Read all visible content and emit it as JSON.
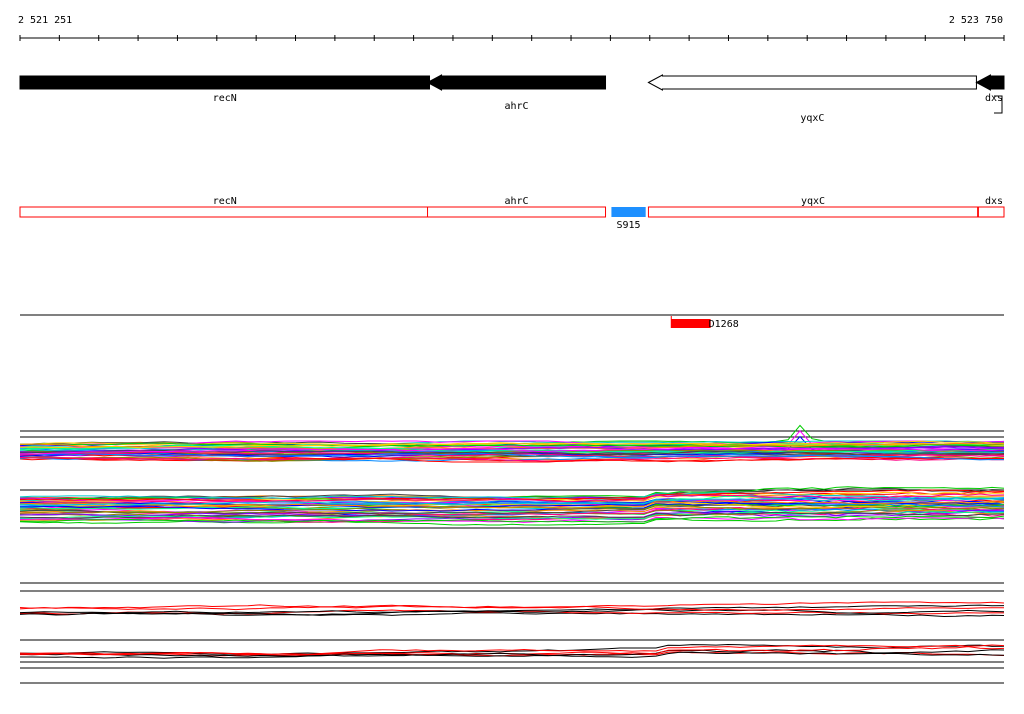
{
  "axis": {
    "start_label": "2 521 251",
    "end_label": "2 523 750",
    "start": 2521251,
    "end": 2523750,
    "tick_count": 26
  },
  "genes": [
    {
      "label": "recN",
      "strand": "-",
      "style": "filled",
      "start": 2521251,
      "end": 2522291
    },
    {
      "label": "ahrC",
      "strand": "-",
      "style": "filled",
      "start": 2522286,
      "end": 2522738
    },
    {
      "label": "yqxC",
      "strand": "-",
      "style": "outline",
      "start": 2522847,
      "end": 2523680
    },
    {
      "label": "dxs",
      "strand": "-",
      "style": "filled",
      "start": 2523680,
      "end": 2523750
    }
  ],
  "transcripts": [
    {
      "label": "recN",
      "start": 2521251,
      "end": 2522291
    },
    {
      "label": "ahrC",
      "start": 2522286,
      "end": 2522738
    },
    {
      "label": "yqxC",
      "start": 2522847,
      "end": 2523683
    },
    {
      "label": "dxs",
      "start": 2523685,
      "end": 2523750
    }
  ],
  "features": [
    {
      "label": "S915",
      "color": "#1e90ff",
      "start": 2522753,
      "end": 2522840
    }
  ],
  "peaks": [
    {
      "label": "D1268",
      "color": "#ff0000",
      "start": 2522905,
      "end": 2523005
    }
  ],
  "colors": {
    "transcript_outline": "#ff0000",
    "track_line": "#000000",
    "profile_palette": [
      "#ff00ff",
      "#00cc00",
      "#0000ff",
      "#ff8800",
      "#00cccc",
      "#ff0000",
      "#888800",
      "#8800ff",
      "#00ff88",
      "#ff0088",
      "#ffcc00",
      "#0088ff",
      "#444444"
    ]
  }
}
